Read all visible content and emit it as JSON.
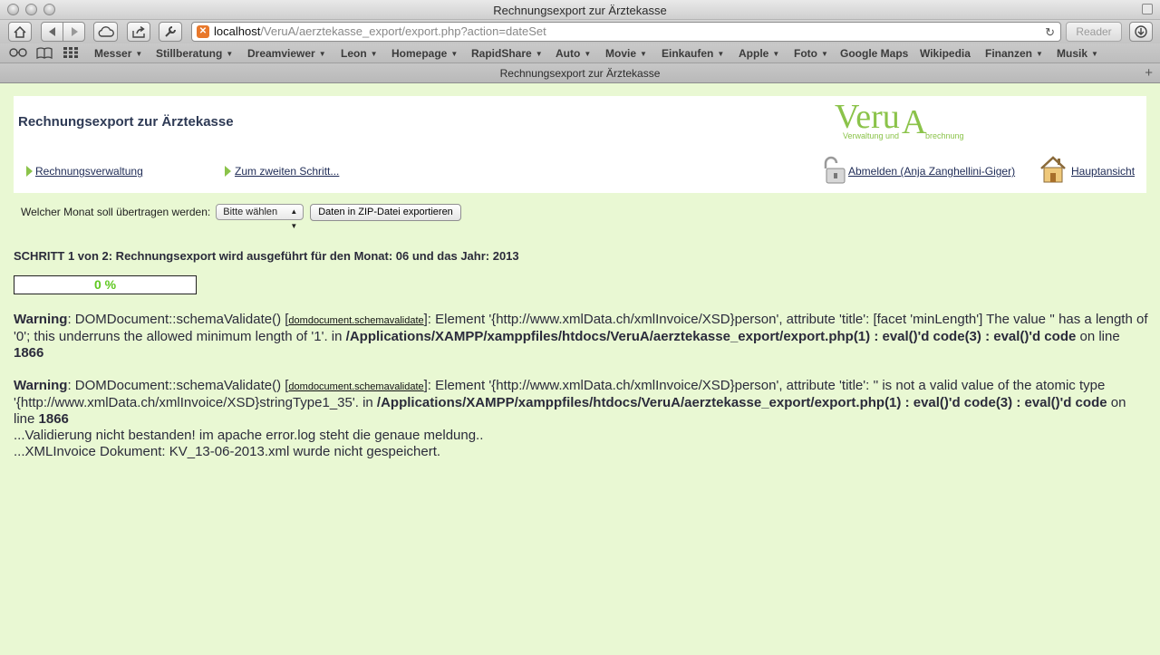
{
  "window": {
    "title": "Rechnungsexport zur Ärztekasse"
  },
  "toolbar": {
    "url_host": "localhost",
    "url_path": "/VeruA/aerztekasse_export/export.php?action=dateSet",
    "reader_label": "Reader"
  },
  "bookmarks": [
    {
      "label": "Messer",
      "dropdown": true
    },
    {
      "label": "Stillberatung",
      "dropdown": true
    },
    {
      "label": "Dreamviewer",
      "dropdown": true
    },
    {
      "label": "Leon",
      "dropdown": true
    },
    {
      "label": "Homepage",
      "dropdown": true
    },
    {
      "label": "RapidShare",
      "dropdown": true
    },
    {
      "label": "Auto",
      "dropdown": true
    },
    {
      "label": "Movie",
      "dropdown": true
    },
    {
      "label": "Einkaufen",
      "dropdown": true
    },
    {
      "label": "Apple",
      "dropdown": true
    },
    {
      "label": "Foto",
      "dropdown": true
    },
    {
      "label": "Google Maps",
      "dropdown": false
    },
    {
      "label": "Wikipedia",
      "dropdown": false
    },
    {
      "label": "Finanzen",
      "dropdown": true
    },
    {
      "label": "Musik",
      "dropdown": true
    }
  ],
  "tab": {
    "title": "Rechnungsexport zur Ärztekasse"
  },
  "header": {
    "title": "Rechnungsexport zur Ärztekasse",
    "logo_big_1": "Veru",
    "logo_big_2": "A",
    "logo_small_1": "Verwaltung und",
    "logo_small_2": "brechnung",
    "nav": {
      "rechnungsverwaltung": "Rechnungsverwaltung",
      "next_step": "Zum zweiten Schritt...",
      "logout": "Abmelden (Anja Zanghellini-Giger)",
      "main_view": "Hauptansicht"
    }
  },
  "form": {
    "month_label": "Welcher Monat soll übertragen werden:",
    "month_select_value": "Bitte wählen",
    "export_button": "Daten in ZIP-Datei exportieren"
  },
  "step": {
    "text": "SCHRITT 1 von 2: Rechnungsexport wird ausgeführt für den Monat: 06 und das Jahr: 2013",
    "progress_label": "0 %",
    "progress_fraction": 0
  },
  "warnings": [
    {
      "label": "Warning",
      "func": ": DOMDocument::schemaValidate() [",
      "link": "domdocument.schemavalidate",
      "message": "]: Element '{http://www.xmlData.ch/xmlInvoice/XSD}person', attribute 'title': [facet 'minLength'] The value '' has a length of '0'; this underruns the allowed minimum length of '1'. in ",
      "path": "/Applications/XAMPP/xamppfiles/htdocs/VeruA/aerztekasse_export/export.php(1) : eval()'d code(3) : eval()'d code",
      "on_line": " on line ",
      "line": "1866"
    },
    {
      "label": "Warning",
      "func": ": DOMDocument::schemaValidate() [",
      "link": "domdocument.schemavalidate",
      "message": "]: Element '{http://www.xmlData.ch/xmlInvoice/XSD}person', attribute 'title': '' is not a valid value of the atomic type '{http://www.xmlData.ch/xmlInvoice/XSD}stringType1_35'. in ",
      "path": "/Applications/XAMPP/xamppfiles/htdocs/VeruA/aerztekasse_export/export.php(1) : eval()'d code(3) : eval()'d code",
      "on_line": " on line ",
      "line": "1866"
    }
  ],
  "messages": [
    "...Validierung nicht bestanden! im apache error.log steht die genaue meldung..",
    "...XMLInvoice Dokument: KV_13-06-2013.xml wurde nicht gespeichert."
  ]
}
